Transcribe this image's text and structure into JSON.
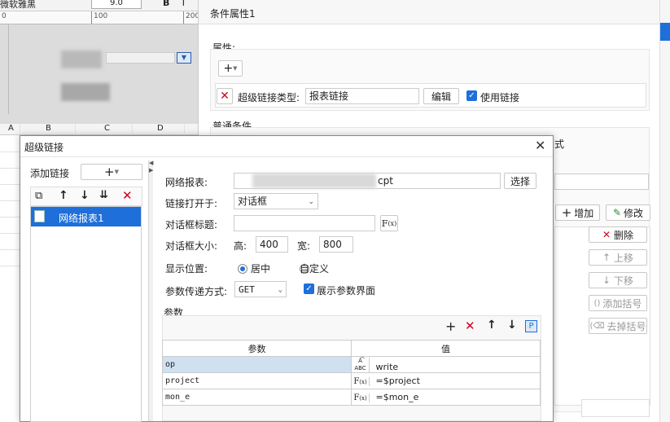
{
  "background": {
    "font_select": "微软雅黑",
    "size_select": "9.0",
    "ruler_ticks": [
      "100",
      "200"
    ],
    "column_headers": [
      "A",
      "B",
      "C",
      "D"
    ]
  },
  "prop_panel": {
    "title": "条件属性1",
    "attr_label": "属性:",
    "link_type_label": "超级链接类型:",
    "link_type_value": "报表链接",
    "edit_button": "编辑",
    "use_link_label": "使用链接",
    "common_condition_label": "普通条件",
    "partial_text": "式",
    "add_button": "增加",
    "modify_button": "修改",
    "delete_button": "删除",
    "move_up_button": "上移",
    "move_down_button": "下移",
    "add_bracket_button": "添加括号",
    "remove_bracket_button": "去掉括号"
  },
  "dialog": {
    "title": "超级链接",
    "add_link_label": "添加链接",
    "tree_items": [
      {
        "label": "网络报表1"
      }
    ],
    "form": {
      "report_label": "网络报表:",
      "report_value_suffix": "cpt",
      "select_button": "选择",
      "open_in_label": "链接打开于:",
      "open_in_value": "对话框",
      "dialog_title_label": "对话框标题:",
      "dialog_size_label": "对话框大小:",
      "height_label": "高:",
      "height_value": "400",
      "width_label": "宽:",
      "width_value": "800",
      "position_label": "显示位置:",
      "position_center": "居中",
      "position_custom": "自定义",
      "param_method_label": "参数传递方式:",
      "param_method_value": "GET",
      "show_param_ui_label": "展示参数界面"
    },
    "params": {
      "section_label": "参数",
      "col_param": "参数",
      "col_value": "值",
      "rows": [
        {
          "name": "op",
          "value": "write"
        },
        {
          "name": "project",
          "value": "=$project"
        },
        {
          "name": "mon_e",
          "value": "=$mon_e"
        }
      ]
    }
  }
}
